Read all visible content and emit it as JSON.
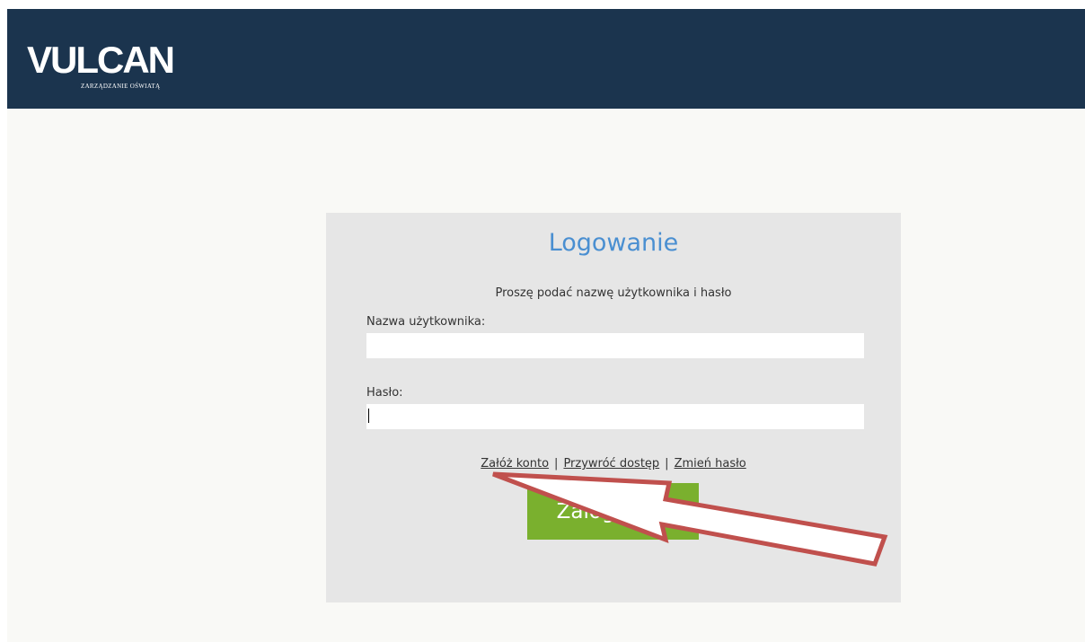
{
  "header": {
    "logo_text": "VULCAN",
    "logo_subtitle": "ZARZĄDZANIE OŚWIATĄ",
    "background_color": "#1b344e"
  },
  "login": {
    "title": "Logowanie",
    "hint": "Proszę podać nazwę użytkownika i hasło",
    "username_label": "Nazwa użytkownika:",
    "username_value": "",
    "password_label": "Hasło:",
    "password_value": "",
    "links": {
      "create_account": "Załóż konto",
      "restore_access": "Przywróć dostęp",
      "change_password": "Zmień hasło",
      "separator": "|"
    },
    "submit_label": "Zaloguj się",
    "title_color": "#4a8fd1",
    "button_color": "#7ab02e"
  },
  "annotation": {
    "icon": "arrow-pointer-icon",
    "fill_color": "#ffffff",
    "stroke_color": "#c0504d"
  }
}
